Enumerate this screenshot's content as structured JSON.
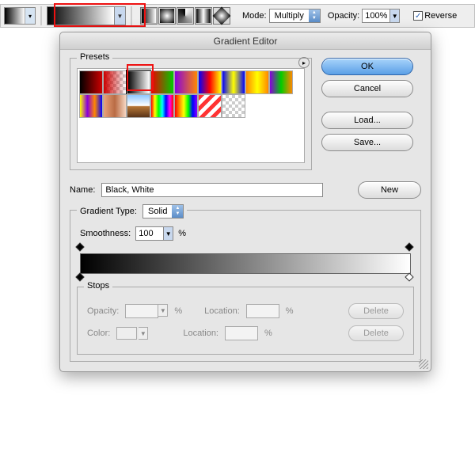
{
  "options_bar": {
    "gradient_types": [
      "linear",
      "radial",
      "angular",
      "reflected",
      "diamond"
    ],
    "mode_label": "Mode:",
    "mode_value": "Multiply",
    "opacity_label": "Opacity:",
    "opacity_value": "100%",
    "reverse_label": "Reverse",
    "reverse_checked": true
  },
  "dialog": {
    "title": "Gradient Editor",
    "presets_label": "Presets",
    "presets": [
      "fg-to-bg",
      "fg-to-transparent",
      "black-white",
      "red-green",
      "violet-orange",
      "blue-red-yellow",
      "blue-yellow-blue",
      "orange-yellow-orange",
      "violet-green-orange",
      "yellow-violet-orange-blue",
      "copper",
      "chrome",
      "spectrum",
      "rainbow",
      "stripes",
      "transparent-stripes"
    ],
    "selected_preset_index": 2,
    "buttons": {
      "ok": "OK",
      "cancel": "Cancel",
      "load": "Load...",
      "save": "Save...",
      "new": "New"
    },
    "name_label": "Name:",
    "name_value": "Black, White",
    "type_label": "Gradient Type:",
    "type_value": "Solid",
    "smooth_label": "Smoothness:",
    "smooth_value": "100",
    "smooth_suffix": "%",
    "stops": {
      "legend": "Stops",
      "opacity_label": "Opacity:",
      "opacity_value": "",
      "opacity_suffix": "%",
      "location_label": "Location:",
      "location_value": "",
      "location_suffix": "%",
      "color_label": "Color:",
      "delete_label": "Delete"
    }
  }
}
